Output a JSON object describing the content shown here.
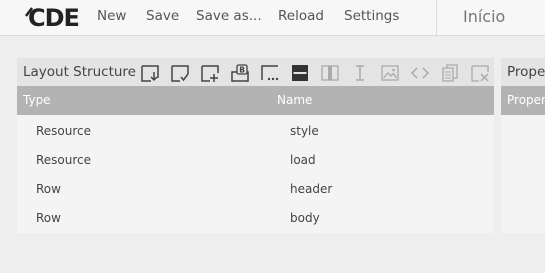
{
  "app": {
    "logo": "CDE"
  },
  "menu": {
    "new": "New",
    "save": "Save",
    "save_as": "Save as...",
    "reload": "Reload",
    "settings": "Settings"
  },
  "header": {
    "page_title": "Início"
  },
  "layout_panel": {
    "title": "Layout Structure",
    "toolbar_icons": [
      "save-template-icon",
      "apply-template-icon",
      "add-resource-icon",
      "add-bootstrap-panel-icon",
      "add-row-icon",
      "add-columns-icon",
      "add-space-icon",
      "add-text-icon",
      "add-image-icon",
      "add-html-icon",
      "duplicate-icon",
      "delete-icon"
    ],
    "columns": [
      "Type",
      "Name"
    ],
    "rows": [
      {
        "type": "Resource",
        "name": "style"
      },
      {
        "type": "Resource",
        "name": "load"
      },
      {
        "type": "Row",
        "name": "header"
      },
      {
        "type": "Row",
        "name": "body"
      }
    ]
  },
  "properties_panel": {
    "title": "Prope",
    "column": "Proper"
  },
  "colors": {
    "header_gray": "#b3b3b3",
    "panel_bg": "#f4f4f4",
    "toolbar_bg": "#e4e4e4"
  }
}
